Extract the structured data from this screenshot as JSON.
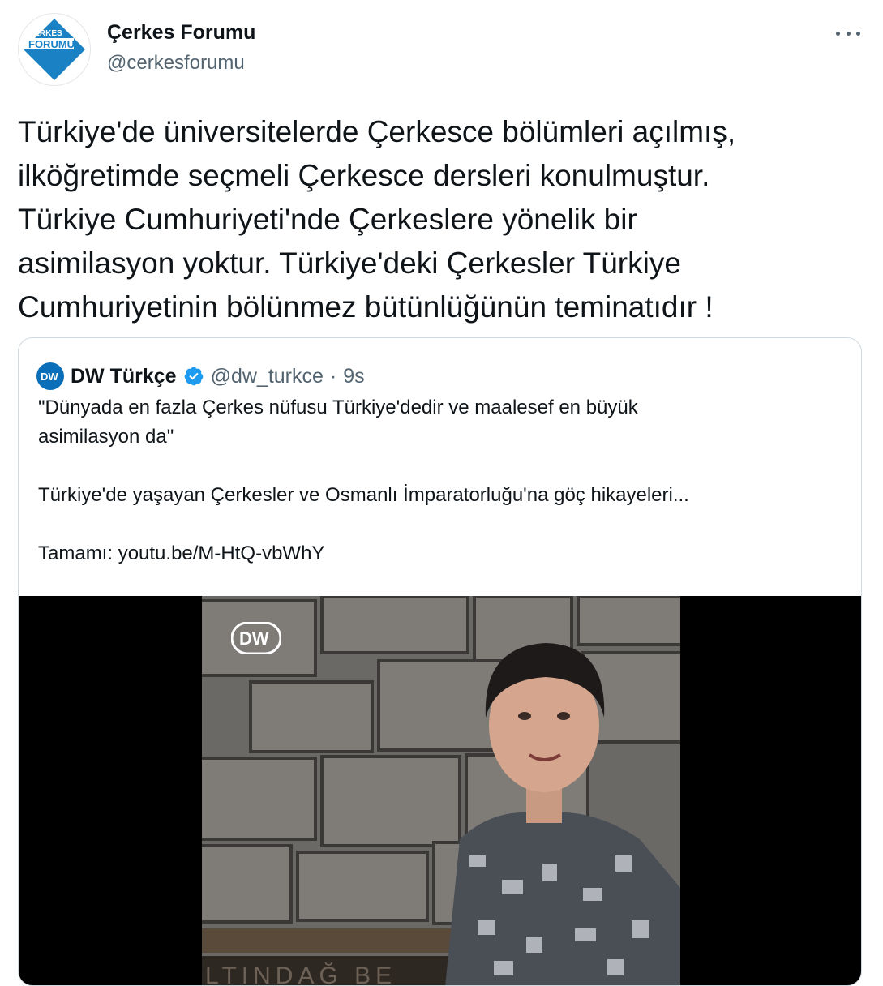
{
  "tweet": {
    "author": {
      "name": "Çerkes Forumu",
      "handle": "@cerkesforumu",
      "avatar_text_top": "ÇERKES",
      "avatar_text_bottom": "FORUMU"
    },
    "text": "Türkiye'de üniversitelerde Çerkesce bölümleri açılmış,\nilköğretimde seçmeli Çerkesce dersleri konulmuştur.\nTürkiye Cumhuriyeti'nde Çerkeslere yönelik bir\nasimilasyon yoktur. Türkiye'deki Çerkesler Türkiye\nCumhuriyetinin bölünmez bütünlüğünün teminatıdır !",
    "more_icon": "ellipsis-icon"
  },
  "quoted": {
    "author_name": "DW Türkçe",
    "verified": true,
    "handle": "@dw_turkce",
    "separator": "·",
    "time": "9s",
    "line1": "\"Dünyada en fazla Çerkes nüfusu Türkiye'dedir ve maalesef en büyük",
    "line2": "asimilasyon da\"",
    "line3": "Türkiye'de yaşayan Çerkesler ve Osmanlı İmparatorluğu'na göç hikayeleri...",
    "link_prefix": "Tamamı: ",
    "link": "youtu.be/M-HtQ-vbWhY",
    "media": {
      "watermark": "DW",
      "bench_text": "LTINDAĞ BE"
    }
  },
  "colors": {
    "text": "#0f1419",
    "secondary": "#536471",
    "verified": "#1d9bf0",
    "border": "#cfd9de",
    "logo_blue": "#1a82c4"
  }
}
